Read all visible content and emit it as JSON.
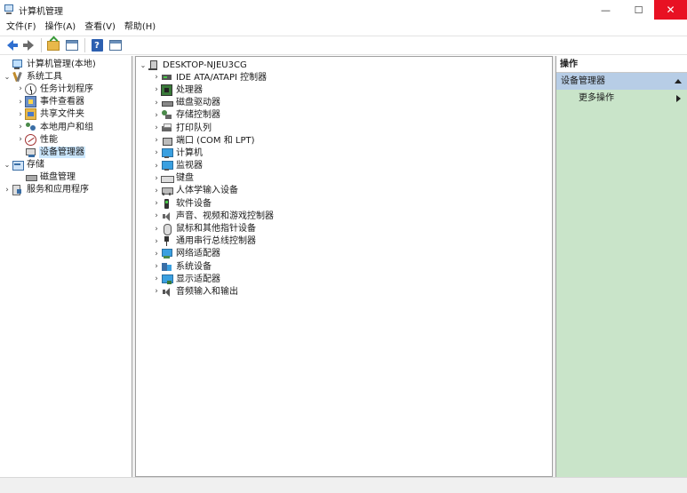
{
  "window": {
    "title": "计算机管理",
    "minimize_glyph": "—",
    "maximize_glyph": "☐",
    "close_glyph": "✕"
  },
  "menu": [
    "文件(F)",
    "操作(A)",
    "查看(V)",
    "帮助(H)"
  ],
  "toolbar": {
    "help_glyph": "?",
    "icons": [
      "back-arrow-icon",
      "forward-arrow-icon",
      "up-folder-icon",
      "show-hide-tree-icon",
      "help-icon",
      "properties-icon"
    ]
  },
  "left_tree": [
    {
      "label": "计算机管理(本地)",
      "level": 0,
      "caret": "",
      "icon": "i-computer",
      "name": "computer-management-local-icon"
    },
    {
      "label": "系统工具",
      "level": 0,
      "caret": "open",
      "icon": "i-tools",
      "name": "system-tools-icon"
    },
    {
      "label": "任务计划程序",
      "level": 1,
      "caret": "closed",
      "icon": "i-clock",
      "name": "task-scheduler-icon"
    },
    {
      "label": "事件查看器",
      "level": 1,
      "caret": "closed",
      "icon": "i-event",
      "name": "event-viewer-icon"
    },
    {
      "label": "共享文件夹",
      "level": 1,
      "caret": "closed",
      "icon": "i-share",
      "name": "shared-folders-icon"
    },
    {
      "label": "本地用户和组",
      "level": 1,
      "caret": "closed",
      "icon": "i-users",
      "name": "local-users-groups-icon"
    },
    {
      "label": "性能",
      "level": 1,
      "caret": "closed",
      "icon": "i-perf",
      "name": "performance-icon"
    },
    {
      "label": "设备管理器",
      "level": 1,
      "caret": "",
      "icon": "i-devmgr",
      "name": "device-manager-icon",
      "selected": true
    },
    {
      "label": "存储",
      "level": 0,
      "caret": "open",
      "icon": "i-storage",
      "name": "storage-icon"
    },
    {
      "label": "磁盘管理",
      "level": 1,
      "caret": "",
      "icon": "i-disk",
      "name": "disk-management-icon"
    },
    {
      "label": "服务和应用程序",
      "level": 0,
      "caret": "closed",
      "icon": "i-services",
      "name": "services-applications-icon"
    }
  ],
  "device_tree": {
    "root": {
      "label": "DESKTOP-NJEU3CG",
      "icon": "i-desktop",
      "name": "desktop-computer-icon"
    },
    "categories": [
      {
        "label": "IDE ATA/ATAPI 控制器",
        "icon": "i-ide",
        "name": "ide-controller-icon"
      },
      {
        "label": "处理器",
        "icon": "i-cpu",
        "name": "processor-icon"
      },
      {
        "label": "磁盘驱动器",
        "icon": "i-hdd",
        "name": "disk-drive-icon"
      },
      {
        "label": "存储控制器",
        "icon": "i-storctl",
        "name": "storage-controller-icon"
      },
      {
        "label": "打印队列",
        "icon": "i-printer",
        "name": "printer-icon"
      },
      {
        "label": "端口 (COM 和 LPT)",
        "icon": "i-port",
        "name": "port-icon"
      },
      {
        "label": "计算机",
        "icon": "i-monitor",
        "name": "computer-icon"
      },
      {
        "label": "监视器",
        "icon": "i-monitor",
        "name": "monitor-icon"
      },
      {
        "label": "键盘",
        "icon": "i-keyboard",
        "name": "keyboard-icon"
      },
      {
        "label": "人体学输入设备",
        "icon": "i-hid",
        "name": "hid-icon"
      },
      {
        "label": "软件设备",
        "icon": "i-software",
        "name": "software-device-icon"
      },
      {
        "label": "声音、视频和游戏控制器",
        "icon": "i-sound",
        "name": "sound-icon"
      },
      {
        "label": "鼠标和其他指针设备",
        "icon": "i-mouse",
        "name": "mouse-icon"
      },
      {
        "label": "通用串行总线控制器",
        "icon": "i-usb",
        "name": "usb-icon"
      },
      {
        "label": "网络适配器",
        "icon": "i-net",
        "name": "network-adapter-icon"
      },
      {
        "label": "系统设备",
        "icon": "i-sysdev",
        "name": "system-device-icon"
      },
      {
        "label": "显示适配器",
        "icon": "i-display",
        "name": "display-adapter-icon"
      },
      {
        "label": "音频输入和输出",
        "icon": "i-audio",
        "name": "audio-io-icon"
      }
    ]
  },
  "actions": {
    "header": "操作",
    "section": "设备管理器",
    "items": [
      "更多操作"
    ]
  },
  "colors": {
    "actions_bg": "#c9e4c9",
    "actions_section_bg": "#b7cde6",
    "close_button": "#e81123",
    "selection": "#cce8ff"
  }
}
